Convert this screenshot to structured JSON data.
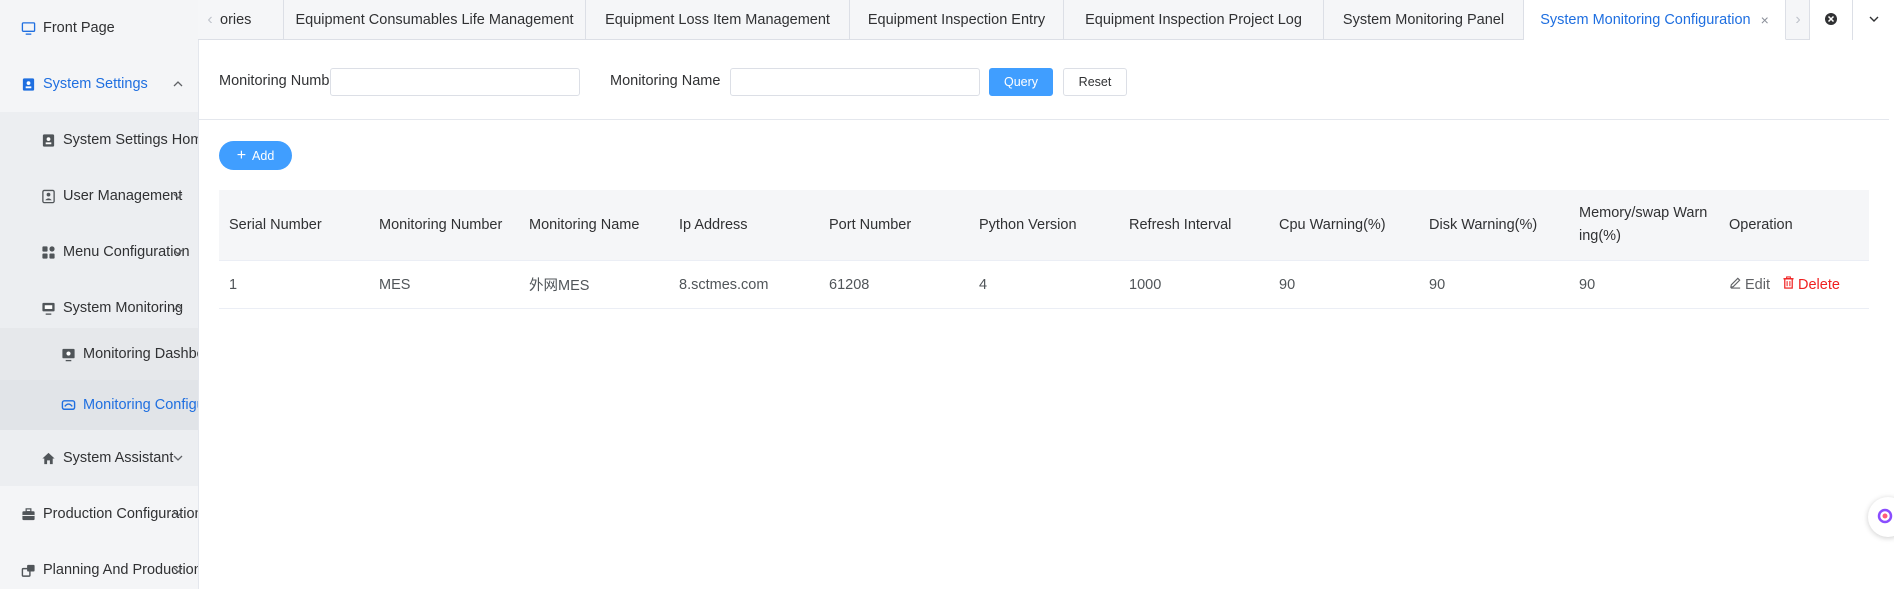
{
  "sidebar": {
    "items": [
      {
        "label": "Front Page",
        "icon": "monitor-icon"
      },
      {
        "label": "System Settings",
        "icon": "settings-icon"
      },
      {
        "label": "System Settings Home",
        "icon": "home-settings-icon"
      },
      {
        "label": "User Management",
        "icon": "user-icon"
      },
      {
        "label": "Menu Configuration",
        "icon": "grid-icon"
      },
      {
        "label": "System Monitoring",
        "icon": "screen-icon"
      },
      {
        "label": "Monitoring Dashboard",
        "icon": "dashboard-icon"
      },
      {
        "label": "Monitoring Configuration",
        "icon": "config-icon"
      },
      {
        "label": "System Assistant",
        "icon": "house-icon"
      },
      {
        "label": "Production Configuration",
        "icon": "briefcase-icon"
      },
      {
        "label": "Planning And Production",
        "icon": "windows-icon"
      }
    ]
  },
  "tabs": [
    {
      "label": "ories"
    },
    {
      "label": "Equipment Consumables Life Management"
    },
    {
      "label": "Equipment Loss Item Management"
    },
    {
      "label": "Equipment Inspection Entry"
    },
    {
      "label": "Equipment Inspection Project Log"
    },
    {
      "label": "System Monitoring Panel"
    },
    {
      "label": "System Monitoring Configuration",
      "active": true,
      "close": "×"
    }
  ],
  "search": {
    "number_label": "Monitoring Number",
    "number_value": "",
    "name_label": "Monitoring Name",
    "name_value": "",
    "query_label": "Query",
    "reset_label": "Reset"
  },
  "toolbar": {
    "add_label": "Add"
  },
  "table": {
    "headers": {
      "serial": "Serial Number",
      "mon_number": "Monitoring Number",
      "mon_name": "Monitoring Name",
      "ip": "Ip Address",
      "port": "Port Number",
      "python": "Python Version",
      "refresh": "Refresh Interval",
      "cpu": "Cpu Warning(%)",
      "disk": "Disk Warning(%)",
      "memory": "Memory/swap Warning(%)",
      "operation": "Operation"
    },
    "rows": [
      {
        "serial": "1",
        "mon_number": "MES",
        "mon_name": "外网MES",
        "ip": "8.sctmes.com",
        "port": "61208",
        "python": "4",
        "refresh": "1000",
        "cpu": "90",
        "disk": "90",
        "memory": "90",
        "edit": "Edit",
        "delete": "Delete"
      }
    ]
  },
  "colors": {
    "accent": "#1f6fe0",
    "primary_button": "#409eff",
    "danger": "#f01f1f"
  }
}
